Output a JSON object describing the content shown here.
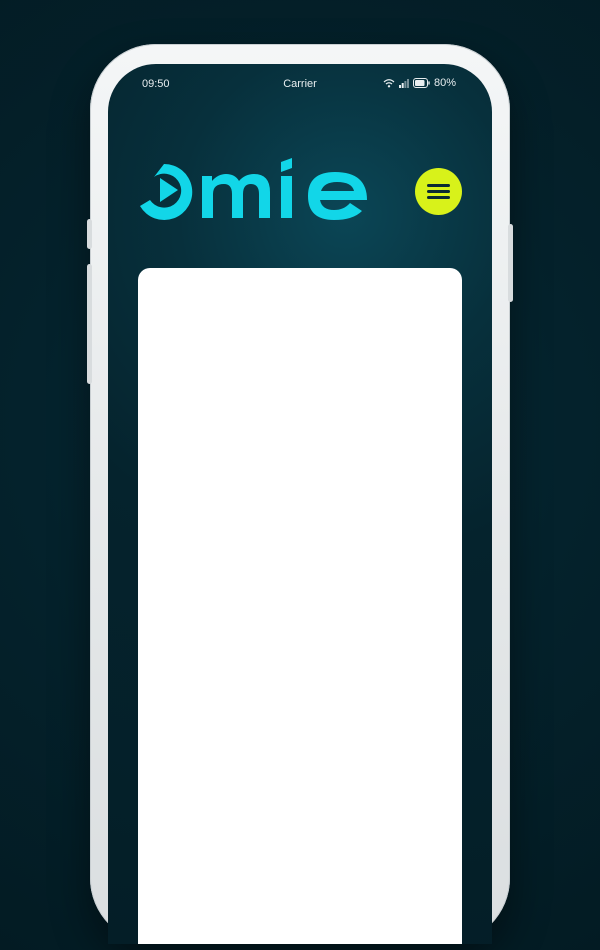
{
  "status_bar": {
    "time": "09:50",
    "carrier": "Carrier",
    "battery": "80%",
    "icons": [
      "wifi-icon",
      "signal-icon",
      "battery-icon"
    ]
  },
  "header": {
    "logo_text": "omie",
    "menu_icon": "hamburger-menu-icon"
  },
  "colors": {
    "background": "#041e27",
    "logo": "#12d6e8",
    "menu_button": "#d8f21a",
    "card": "#ffffff"
  }
}
